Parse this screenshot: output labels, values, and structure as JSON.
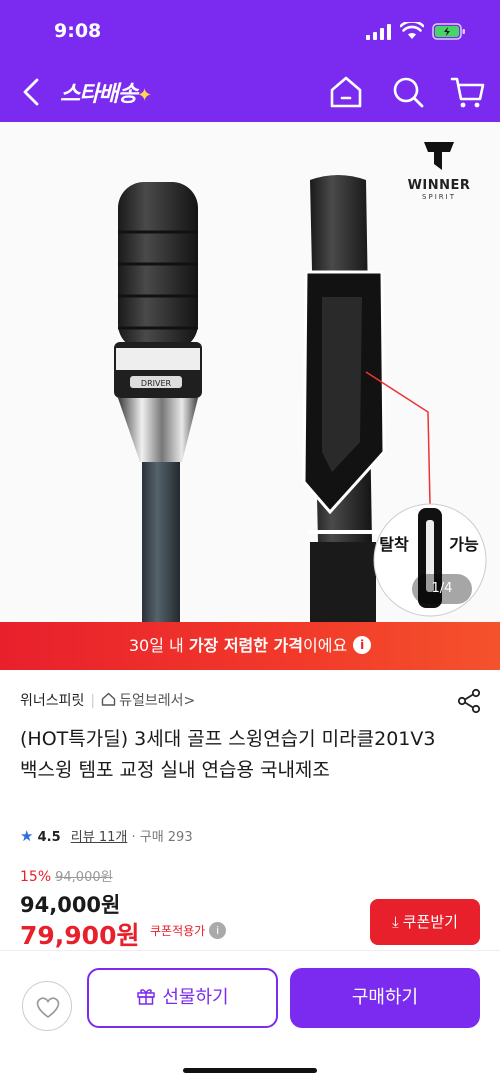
{
  "status_bar": {
    "time": "9:08"
  },
  "header": {
    "logo_text": "스타배송",
    "logo_spark": "✦",
    "icons": [
      "back-icon",
      "home-icon",
      "search-icon",
      "cart-icon"
    ]
  },
  "hero": {
    "brand_name": "WINNER",
    "brand_sub": "SPIRIT",
    "label_detach": "탈착",
    "label_possible": "가능",
    "dial_label": "DRIVER",
    "image_counter": "1/4"
  },
  "promo": {
    "prefix": "30일 내 ",
    "bold": "가장 저렴한 가격",
    "suffix": "이에요",
    "info": "i"
  },
  "product": {
    "seller": "위너스피릿",
    "delivery": "듀얼브레서",
    "delivery_chevron": ">",
    "title": "(HOT특가딜) 3세대 골프 스윙연습기 미라클201V3 백스윙 템포 교정 실내 연습용 국내제조",
    "rating": "4.5",
    "reviews": "리뷰 11개",
    "purchases": "· 구매 293",
    "discount_rate": "15%",
    "original_price": "94,000원",
    "price": "94,000원",
    "coupon_price": "79,900원",
    "coupon_label": "쿠폰적용가",
    "coupon_help": "i",
    "coupon_button": "쿠폰받기"
  },
  "bottom_bar": {
    "gift_button": "선물하기",
    "buy_button": "구매하기"
  },
  "colors": {
    "brand_purple": "#7b2bf0",
    "promo_red": "#e8202c",
    "rating_star": "#2f6fe0"
  }
}
